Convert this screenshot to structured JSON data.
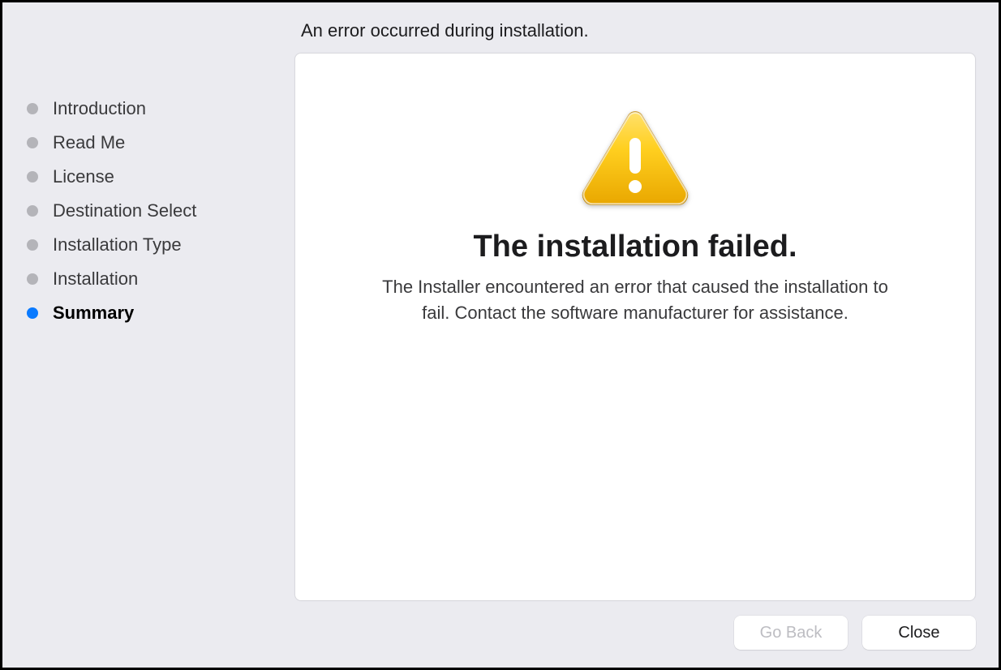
{
  "header": {
    "title": "An error occurred during installation."
  },
  "sidebar": {
    "steps": [
      {
        "label": "Introduction",
        "active": false
      },
      {
        "label": "Read Me",
        "active": false
      },
      {
        "label": "License",
        "active": false
      },
      {
        "label": "Destination Select",
        "active": false
      },
      {
        "label": "Installation Type",
        "active": false
      },
      {
        "label": "Installation",
        "active": false
      },
      {
        "label": "Summary",
        "active": true
      }
    ]
  },
  "main": {
    "icon": "warning-triangle",
    "heading": "The installation failed.",
    "body": "The Installer encountered an error that caused the installation to fail. Contact the software manufacturer for assistance."
  },
  "buttons": {
    "go_back": {
      "label": "Go Back",
      "enabled": false
    },
    "close": {
      "label": "Close",
      "enabled": true
    }
  }
}
